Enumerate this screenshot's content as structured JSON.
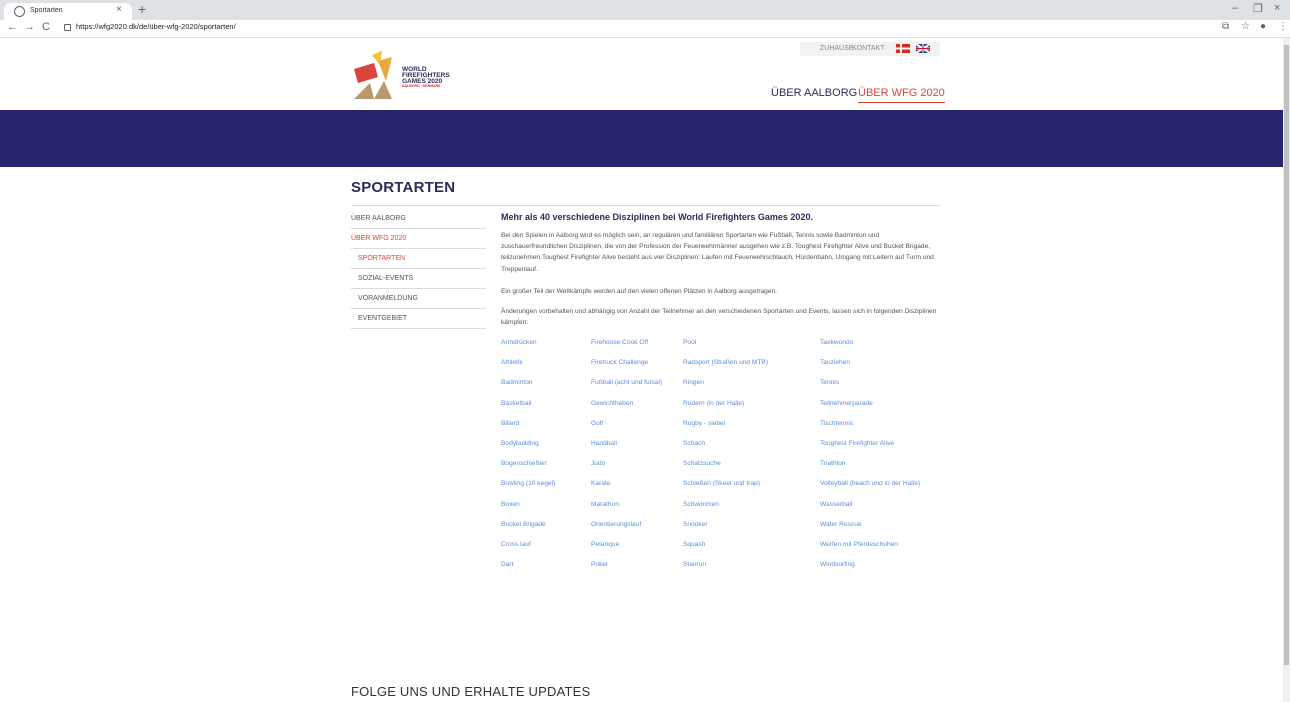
{
  "browser": {
    "tab_title": "Sportarten",
    "url": "https://wfg2020.dk/de/über-wfg-2020/sportarten/"
  },
  "header": {
    "logo_line1": "WORLD",
    "logo_line2": "FIREFIGHTERS",
    "logo_line3": "GAMES 2020",
    "logo_sub": "AALBORG · DENMARK",
    "top_links": [
      "ZUHAUSE",
      "KONTAKT"
    ],
    "main_nav": [
      "ÜBER AALBORG",
      "ÜBER WFG 2020"
    ]
  },
  "colors": {
    "banner": "#26256b",
    "accent": "#d9453d",
    "link": "#5b8fd6",
    "heading": "#2a2d5a"
  },
  "page": {
    "title": "SPORTARTEN",
    "sidenav": [
      {
        "label": "ÜBER AALBORG"
      },
      {
        "label": "ÜBER WFG 2020"
      },
      {
        "label": "SPORTARTEN"
      },
      {
        "label": "SOZIAL-EVENTS"
      },
      {
        "label": "VORANMELDUNG"
      },
      {
        "label": "EVENTGEBIET"
      }
    ],
    "heading": "Mehr als 40 verschiedene Disziplinen bei World Firefighters Games 2020.",
    "paragraphs": [
      "Bei den Spielen in Aalborg wird es möglich sein, an regulären und familiären Sportarten wie Fußball, Tennis sowie Badminton und zuschauerfreundlichen Disziplinen, die von der Profession der Feuerwehrmänner ausgehen wie z.B. Toughest Firefighter Alive und Bucket Brigade, teilzunehmen.Toughest Firefighter Alive besteht aus vier Disziplinen: Laufen mit Feuerwehrschlauch, Hürdenbahn, Umgang mit Leitern auf Turm und Treppenlauf.",
      "Ein großer Teil der Wettkämpfe werden auf den vielen offenen Plätzen in Aalborg ausgetragen.",
      "Änderungen vorbehalten und abhängig von Anzahl der Teilnehmer an den verschiedenen Sportarten und Events, lassen sich in folgenden Disziplinen kämpfen:"
    ],
    "sports": [
      [
        "Armdrücken",
        "Firehouse Cook Off",
        "Pool",
        "Taekwondo"
      ],
      [
        "Athletik",
        "Firetruck Challenge",
        "Radsport (Straßen und MTB)",
        "Tauziehen"
      ],
      [
        "Badminton",
        "Fußball (acht und futsal)",
        "Ringen",
        "Tennis"
      ],
      [
        "Basketball",
        "Gewichtheben",
        "Rudern (in der Halle)",
        "Teilnehmerparade"
      ],
      [
        "Billard",
        "Golf",
        "Rugby - sieber",
        "Tischtennis"
      ],
      [
        "Bodybuilding",
        "Handball",
        "Schach",
        "Toughest Firefighter Alive"
      ],
      [
        "Bogenschießen",
        "Judo",
        "Schatzsuche",
        "Triathlon"
      ],
      [
        "Bowling (10 kegel)",
        "Karate",
        "Schießen (Skeet und trap)",
        "Volleyball (beach und in der Halle)"
      ],
      [
        "Boxen",
        "Marathon",
        "Schwimmen",
        "Wasserball"
      ],
      [
        "Bucket Brigade",
        "Orientierungslauf",
        "Snooker",
        "Water Rescue"
      ],
      [
        "Cross lauf",
        "Petanque",
        "Squash",
        "Werfen mit Pferdeschuhen"
      ],
      [
        "Dart",
        "Poker",
        "Stairrun",
        "Windsurfing"
      ]
    ],
    "footer_title": "FOLGE UNS UND ERHALTE UPDATES"
  }
}
